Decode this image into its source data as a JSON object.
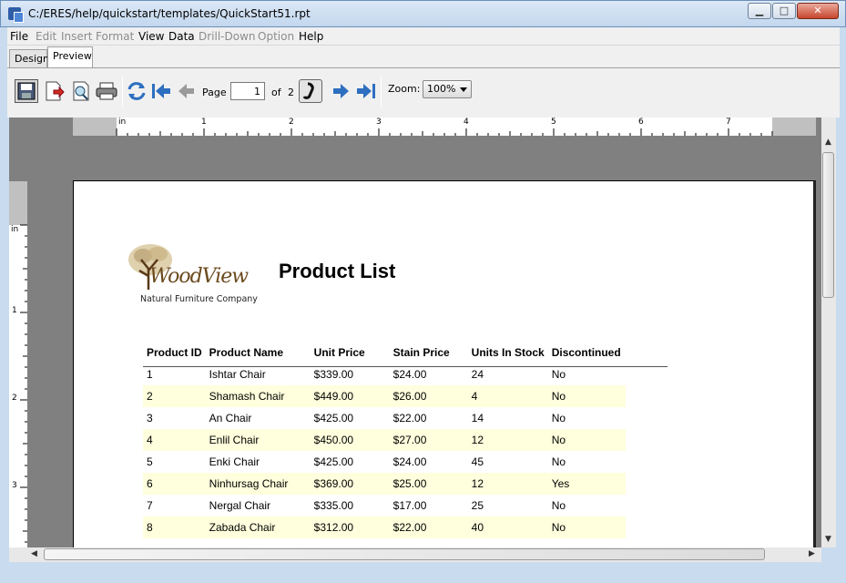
{
  "window": {
    "title": "C:/ERES/help/quickstart/templates/QuickStart51.rpt",
    "minimize": "▁",
    "maximize": "□",
    "close": "✕"
  },
  "menu": [
    "File",
    "Edit",
    "Insert",
    "Format",
    "View",
    "Data",
    "Drill-Down",
    "Option",
    "Help"
  ],
  "tabs": {
    "design": "Design",
    "preview": "Preview"
  },
  "toolbar": {
    "page_label": "Page",
    "page_value": "1",
    "of_label": "of",
    "total_pages": "2",
    "zoom_label": "Zoom:",
    "zoom_value": "100%"
  },
  "ruler": {
    "unit": "in",
    "h_numbers": [
      "1",
      "2",
      "3",
      "4",
      "5",
      "6",
      "7"
    ],
    "v_numbers": [
      "1",
      "2",
      "3"
    ]
  },
  "report": {
    "logo_text": "WoodView",
    "logo_subtitle": "Natural Furniture Company",
    "title": "Product List",
    "columns": [
      "Product ID",
      "Product Name",
      "Unit Price",
      "Stain Price",
      "Units In Stock",
      "Discontinued"
    ],
    "rows": [
      [
        "1",
        "Ishtar Chair",
        "$339.00",
        "$24.00",
        "24",
        "No"
      ],
      [
        "2",
        "Shamash Chair",
        "$449.00",
        "$26.00",
        "4",
        "No"
      ],
      [
        "3",
        "An Chair",
        "$425.00",
        "$22.00",
        "14",
        "No"
      ],
      [
        "4",
        "Enlil Chair",
        "$450.00",
        "$27.00",
        "12",
        "No"
      ],
      [
        "5",
        "Enki Chair",
        "$425.00",
        "$24.00",
        "45",
        "No"
      ],
      [
        "6",
        "Ninhursag Chair",
        "$369.00",
        "$25.00",
        "12",
        "Yes"
      ],
      [
        "7",
        "Nergal Chair",
        "$335.00",
        "$17.00",
        "25",
        "No"
      ],
      [
        "8",
        "Zabada Chair",
        "$312.00",
        "$22.00",
        "40",
        "No"
      ]
    ]
  },
  "colors": {
    "alt_row": "#ffffdd",
    "viewport_bg": "#808080"
  }
}
